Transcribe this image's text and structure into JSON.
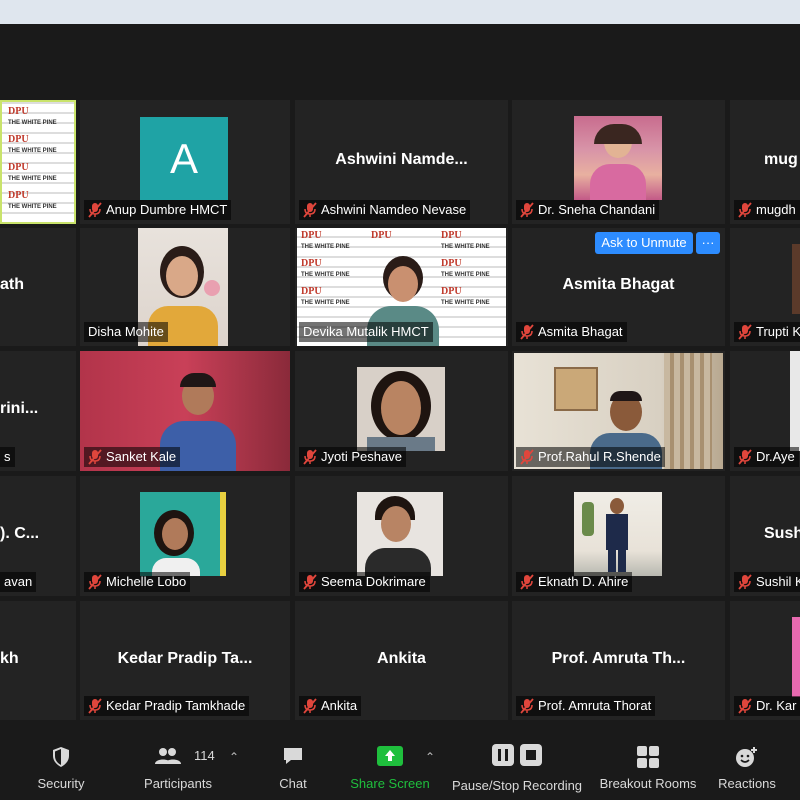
{
  "tiles": {
    "r1c1": {
      "label": ""
    },
    "r1c2": {
      "avatar_letter": "A",
      "label": "Anup Dumbre HMCT"
    },
    "r1c3": {
      "center": "Ashwini  Namde...",
      "label": "Ashwini Namdeo Nevase"
    },
    "r1c4": {
      "label": "Dr. Sneha Chandani"
    },
    "r1c5": {
      "center": "mug",
      "label": "mugdh"
    },
    "r2c1": {
      "center": "ath",
      "label": ""
    },
    "r2c2": {
      "label": "Disha Mohite"
    },
    "r2c3": {
      "label": "Devika Mutalik HMCT"
    },
    "r2c4": {
      "center": "Asmita Bhagat",
      "label": "Asmita Bhagat",
      "ask_unmute": "Ask to Unmute",
      "more": "···"
    },
    "r2c5": {
      "label": "Trupti K"
    },
    "r3c1": {
      "center": "rini...",
      "label": "s"
    },
    "r3c2": {
      "label": "Sanket Kale"
    },
    "r3c3": {
      "label": "Jyoti Peshave"
    },
    "r3c4": {
      "label": "Prof.Rahul R.Shende"
    },
    "r3c5": {
      "label": "Dr.Aye"
    },
    "r4c1": {
      "center": "). C...",
      "label": "avan"
    },
    "r4c2": {
      "label": "Michelle Lobo"
    },
    "r4c3": {
      "label": "Seema Dokrimare"
    },
    "r4c4": {
      "label": "Eknath D. Ahire"
    },
    "r4c5": {
      "center": "Sush",
      "label": "Sushil K"
    },
    "r5c1": {
      "center": "kh",
      "label": ""
    },
    "r5c2": {
      "center": "Kedar Pradip Ta...",
      "label": "Kedar Pradip Tamkhade"
    },
    "r5c3": {
      "center": "Ankita",
      "label": "Ankita"
    },
    "r5c4": {
      "center": "Prof. Amruta Th...",
      "label": "Prof. Amruta Thorat"
    },
    "r5c5": {
      "label": "Dr. Kar"
    }
  },
  "slide": {
    "dpu": "DPU",
    "white_pine": "THE WHITE PINE"
  },
  "toolbar": {
    "security": "Security",
    "participants": "Participants",
    "participants_count": "114",
    "chat": "Chat",
    "share_screen": "Share Screen",
    "pause_stop": "Pause/Stop Recording",
    "breakout": "Breakout Rooms",
    "reactions": "Reactions"
  },
  "colors": {
    "tile_bg": "#232323",
    "app_bg": "#1a1a1a",
    "muted_red": "#e0463c",
    "share_green": "#1fbf3d",
    "accent_blue": "#2d8cff",
    "avatar_teal": "#1fa3a5"
  }
}
